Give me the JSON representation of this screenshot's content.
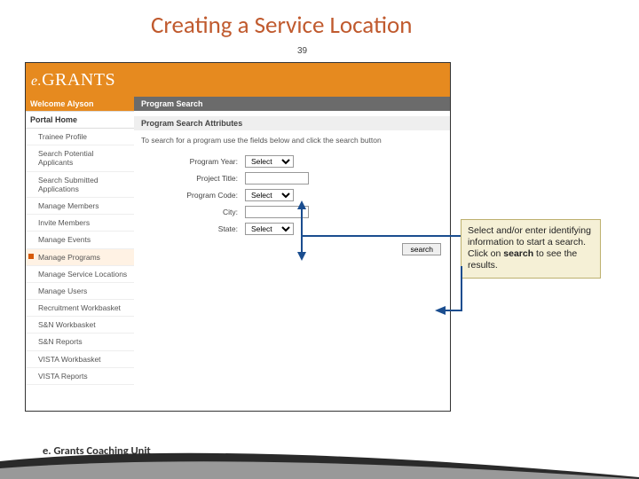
{
  "slide": {
    "title": "Creating a Service Location",
    "number": "39",
    "footer": "e. Grants Coaching Unit"
  },
  "header": {
    "logo_e": "e.",
    "logo_brand": "GRANTS"
  },
  "sidebar": {
    "welcome": "Welcome Alyson",
    "portal_home": "Portal Home",
    "items": [
      "Trainee Profile",
      "Search Potential Applicants",
      "Search Submitted Applications",
      "Manage Members",
      "Invite Members",
      "Manage Events",
      "Manage Programs",
      "Manage Service Locations",
      "Manage Users",
      "Recruitment Workbasket",
      "S&N Workbasket",
      "S&N Reports",
      "VISTA Workbasket",
      "VISTA Reports"
    ],
    "selected_index": 6
  },
  "main": {
    "header": "Program Search",
    "section": "Program Search Attributes",
    "instruction": "To search for a program use the fields below and click the search button",
    "labels": {
      "program_year": "Program Year:",
      "project_title": "Project Title:",
      "program_code": "Program Code:",
      "city": "City:",
      "state": "State:"
    },
    "select_placeholder": "Select",
    "search_btn": "search"
  },
  "callout": {
    "l1": "Select and/or enter identifying information to start a search. Click on ",
    "l2": "search",
    "l3": " to see the results."
  }
}
